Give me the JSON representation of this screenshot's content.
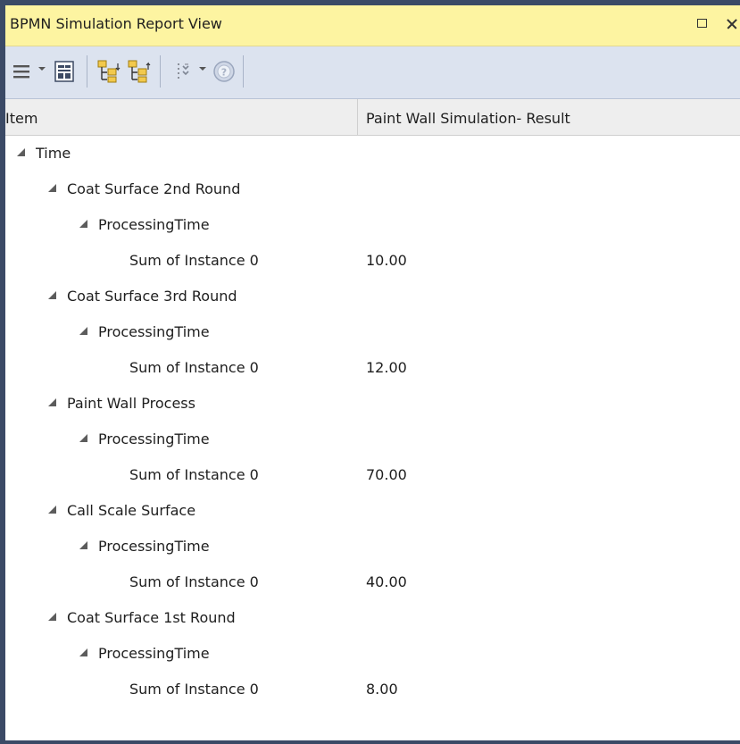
{
  "window": {
    "title": "BPMN Simulation Report View"
  },
  "toolbar": {
    "icons": [
      "menu-icon",
      "run-report-icon",
      "tree-expand-icon",
      "tree-collapse-icon",
      "options-icon",
      "help-icon"
    ]
  },
  "columns": {
    "item": "Item",
    "result": "Paint Wall Simulation- Result"
  },
  "tree": {
    "root": "Time",
    "groups": [
      {
        "name": "Coat Surface 2nd Round",
        "metric": "ProcessingTime",
        "instance": "Sum of Instance 0",
        "value": "10.00"
      },
      {
        "name": "Coat Surface 3rd Round",
        "metric": "ProcessingTime",
        "instance": "Sum of Instance 0",
        "value": "12.00"
      },
      {
        "name": "Paint Wall Process",
        "metric": "ProcessingTime",
        "instance": "Sum of Instance 0",
        "value": "70.00"
      },
      {
        "name": "Call Scale Surface",
        "metric": "ProcessingTime",
        "instance": "Sum of Instance 0",
        "value": "40.00"
      },
      {
        "name": "Coat Surface 1st Round",
        "metric": "ProcessingTime",
        "instance": "Sum of Instance 0",
        "value": "8.00"
      }
    ]
  }
}
